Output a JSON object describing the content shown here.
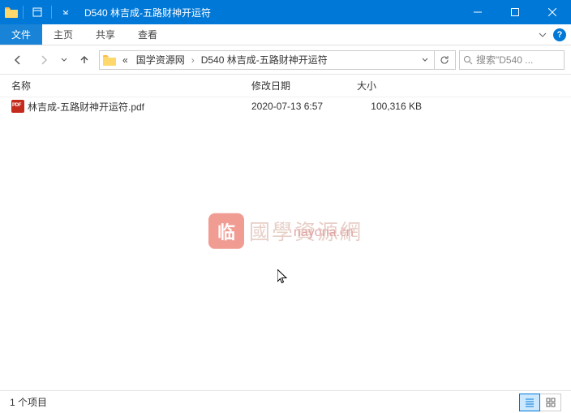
{
  "window": {
    "title": "D540 林吉成-五路财神开运符"
  },
  "ribbon": {
    "file": "文件",
    "tabs": [
      "主页",
      "共享",
      "查看"
    ]
  },
  "breadcrumb": {
    "prefix": "«",
    "items": [
      "国学资源网",
      "D540 林吉成-五路财神开运符"
    ]
  },
  "search": {
    "placeholder": "搜索\"D540 ..."
  },
  "columns": {
    "name": "名称",
    "date": "修改日期",
    "size": "大小"
  },
  "files": [
    {
      "name": "林吉成-五路财神开运符.pdf",
      "date": "2020-07-13 6:57",
      "size": "100,316 KB"
    }
  ],
  "watermark": {
    "badge": "临",
    "text": "國學資源網",
    "domain": "nayona.cn"
  },
  "status": {
    "count": "1 个项目"
  }
}
